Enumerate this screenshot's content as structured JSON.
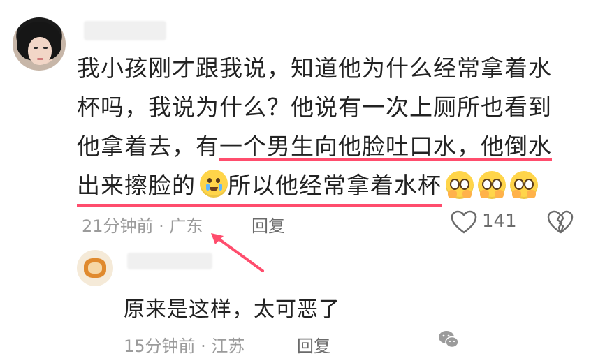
{
  "comment1": {
    "lines": [
      "我小孩刚才跟我说，知道他为什么经常拿着水",
      "杯吗，我说为什么？他说有一次上厕所也看到",
      "他拿着去，有一个男生向他脸吐口水，他倒水",
      "出来擦脸的"
    ],
    "line3_plain": "他拿着去，有",
    "line3_highlight": "一个男生向他脸吐口水，他倒水",
    "line4_plain": "出来擦脸的",
    "line4_after_emoji": "所以他经常拿着水杯",
    "time_location": "21分钟前 · 广东",
    "reply_label": "回复",
    "like_count": "141"
  },
  "comment2": {
    "text": "原来是这样，太可恶了",
    "time_location": "15分钟前 · 江苏",
    "reply_label": "回复"
  },
  "colors": {
    "highlight": "#ff4d6d",
    "meta_text": "#9b9b9b",
    "body_text": "#222222"
  }
}
